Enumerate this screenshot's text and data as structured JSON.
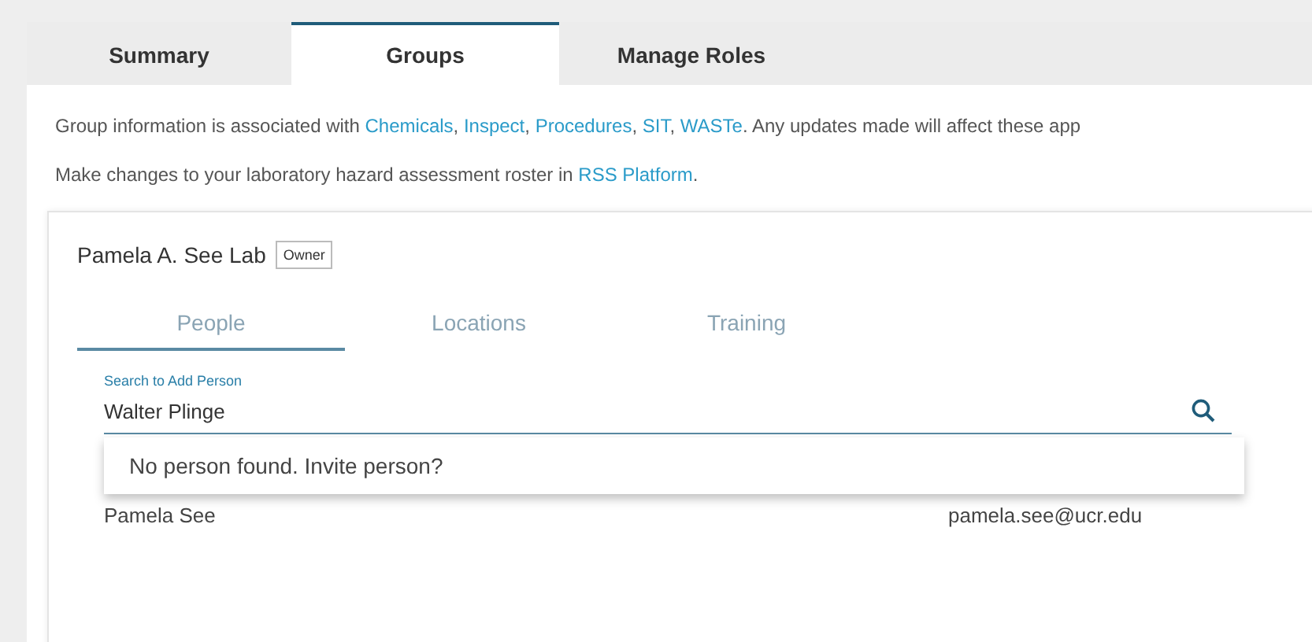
{
  "tabs": [
    {
      "label": "Summary",
      "selected": false
    },
    {
      "label": "Groups",
      "selected": true
    },
    {
      "label": "Manage Roles",
      "selected": false
    }
  ],
  "notices": [
    {
      "before": "Group information is associated with ",
      "links": [
        "Chemicals",
        "Inspect",
        "Procedures",
        "SIT",
        "WASTe"
      ],
      "separator": ", ",
      "after": ". Any updates made will affect these app"
    },
    {
      "before": "Make changes to your laboratory hazard assessment roster in ",
      "links": [
        "RSS Platform"
      ],
      "after": "."
    }
  ],
  "group": {
    "name": "Pamela A. See Lab",
    "badge": "Owner"
  },
  "subtabs": [
    {
      "label": "People",
      "selected": true
    },
    {
      "label": "Locations",
      "selected": false
    },
    {
      "label": "Training",
      "selected": false
    }
  ],
  "search": {
    "label": "Search to Add Person",
    "value": "Walter Plinge"
  },
  "dropdown": {
    "message": "No person found. Invite person?"
  },
  "people": [
    {
      "name": "Pamela See",
      "email": "pamela.see@ucr.edu"
    }
  ]
}
